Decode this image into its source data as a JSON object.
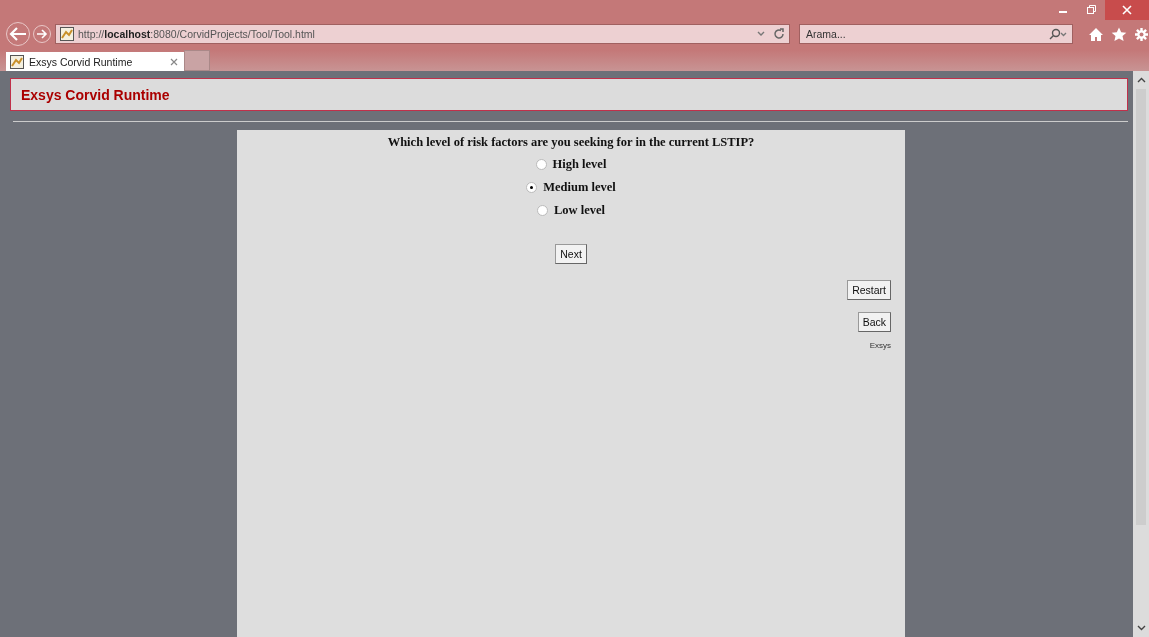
{
  "browser": {
    "address": "http://**localhost**:8080/CorvidProjects/Tool/Tool.html",
    "search": {
      "placeholder": "Arama..."
    },
    "tabs": [
      {
        "label": "Exsys Corvid Runtime",
        "selected": true
      }
    ]
  },
  "header": {
    "title": "Exsys Corvid Runtime"
  },
  "question": {
    "text": "Which level of risk factors are you seeking for in the current LSTIP?",
    "options": [
      {
        "label": "High level",
        "selected": false
      },
      {
        "label": "Medium level",
        "selected": true
      },
      {
        "label": "Low level",
        "selected": false
      }
    ]
  },
  "buttons": {
    "next": "Next",
    "restart": "Restart",
    "back": "Back"
  },
  "footer": "Exsys"
}
